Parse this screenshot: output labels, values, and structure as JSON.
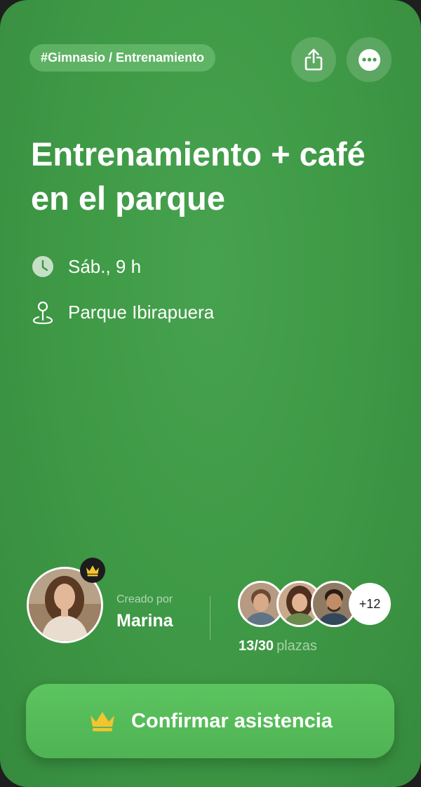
{
  "header": {
    "tag": "#Gimnasio / Entrenamiento",
    "share_icon": "share-icon",
    "more_icon": "more-icon"
  },
  "event": {
    "title": "Entrenamiento + café en el parque",
    "datetime": "Sáb., 9 h",
    "location": "Parque Ibirapuera",
    "datetime_icon": "clock-icon",
    "location_icon": "location-pin-icon"
  },
  "creator": {
    "label": "Creado por",
    "name": "Marina",
    "badge_icon": "crown-icon"
  },
  "attendees": {
    "extra_count": "+12",
    "spots_taken": "13/30",
    "spots_label": "plazas"
  },
  "actions": {
    "confirm_label": "Confirmar asistencia",
    "confirm_icon": "crown-icon"
  },
  "colors": {
    "background": "#41a048",
    "button": "#55bb59",
    "crown": "#f4c430"
  }
}
